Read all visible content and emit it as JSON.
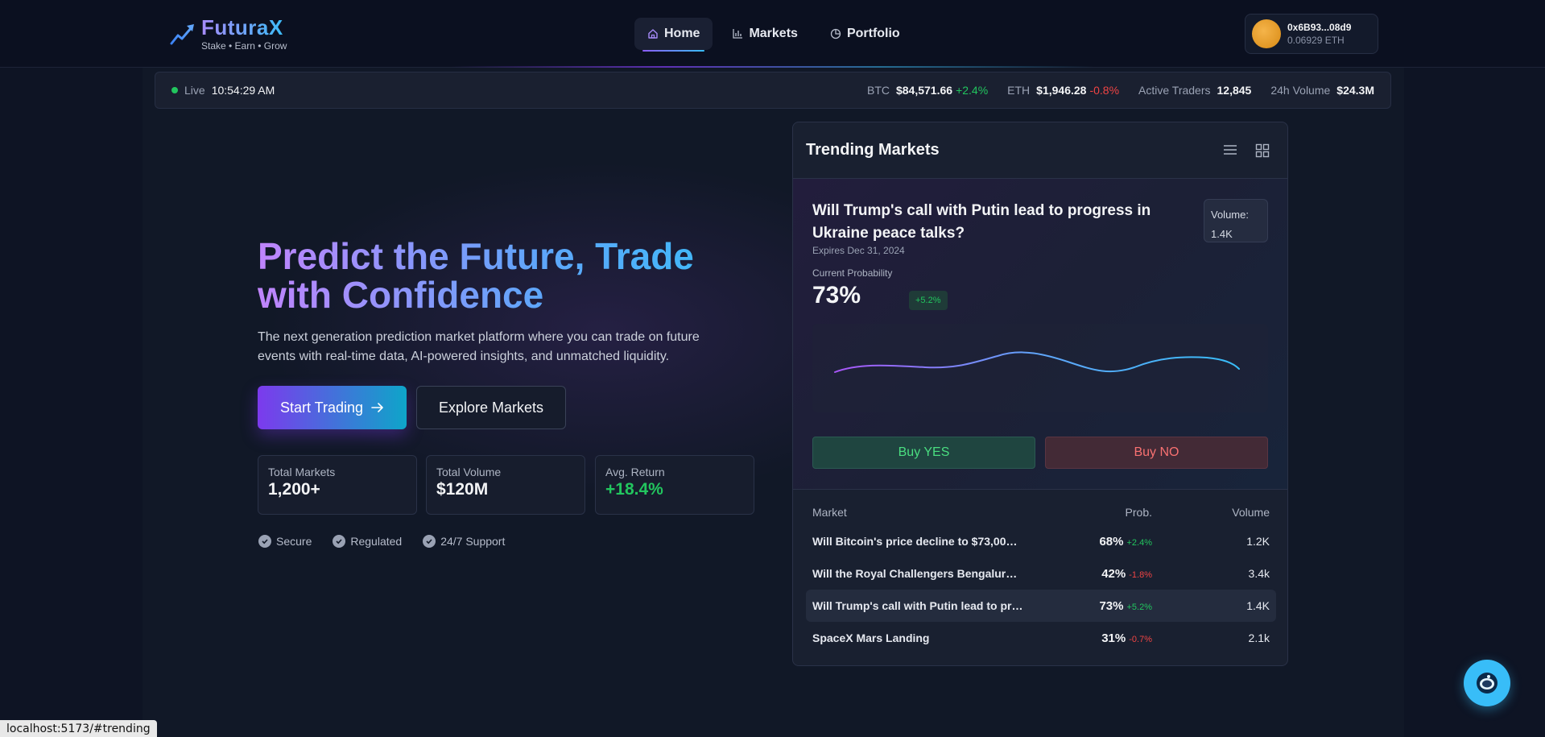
{
  "brand": {
    "name": "FuturaX",
    "tagline": "Stake • Earn • Grow"
  },
  "nav": {
    "items": [
      {
        "label": "Home",
        "icon": "home-icon",
        "active": true
      },
      {
        "label": "Markets",
        "icon": "bar-chart-icon",
        "active": false
      },
      {
        "label": "Portfolio",
        "icon": "pie-chart-icon",
        "active": false
      }
    ]
  },
  "wallet": {
    "address": "0x6B93...08d9",
    "balance": "0.06929 ETH"
  },
  "ticker": {
    "live_label": "Live",
    "time": "10:54:29 AM",
    "btc": {
      "label": "BTC",
      "value": "$84,571.66",
      "change": "+2.4%"
    },
    "eth": {
      "label": "ETH",
      "value": "$1,946.28",
      "change": "-0.8%"
    },
    "traders": {
      "label": "Active Traders",
      "value": "12,845"
    },
    "volume": {
      "label": "24h Volume",
      "value": "$24.3M"
    }
  },
  "hero": {
    "title": "Predict the Future, Trade with Confidence",
    "description": "The next generation prediction market platform where you can trade on future events with real-time data, AI-powered insights, and unmatched liquidity.",
    "primary_cta": "Start Trading",
    "secondary_cta": "Explore Markets",
    "stats": [
      {
        "label": "Total Markets",
        "value": "1,200+"
      },
      {
        "label": "Total Volume",
        "value": "$120M"
      },
      {
        "label": "Avg. Return",
        "value": "+18.4%"
      }
    ],
    "features": [
      "Secure",
      "Regulated",
      "24/7 Support"
    ]
  },
  "trending": {
    "title": "Trending Markets",
    "featured": {
      "question": "Will Trump's call with Putin lead to progress in Ukraine peace talks?",
      "volume_label": "Volume:",
      "volume_value": "1.4K",
      "expires": "Expires Dec 31, 2024",
      "current_prob_label": "Current Probability",
      "probability": "73%",
      "change": "+5.2%",
      "buy_yes": "Buy YES",
      "buy_no": "Buy NO"
    },
    "table": {
      "headers": {
        "market": "Market",
        "prob": "Prob.",
        "volume": "Volume"
      },
      "rows": [
        {
          "market": "Will Bitcoin's price decline to $73,000 ...",
          "prob": "68%",
          "change": "+2.4%",
          "volume": "1.2K"
        },
        {
          "market": "Will the Royal Challengers Bengaluru, ...",
          "prob": "42%",
          "change": "-1.8%",
          "volume": "3.4k"
        },
        {
          "market": "Will Trump's call with Putin lead to pro...",
          "prob": "73%",
          "change": "+5.2%",
          "volume": "1.4K"
        },
        {
          "market": "SpaceX Mars Landing",
          "prob": "31%",
          "change": "-0.7%",
          "volume": "2.1k"
        }
      ]
    }
  },
  "status_url": "localhost:5173/#trending",
  "colors": {
    "accent_purple": "#7c3aed",
    "accent_cyan": "#38bdf8",
    "up": "#22c55e",
    "down": "#ef4444"
  }
}
